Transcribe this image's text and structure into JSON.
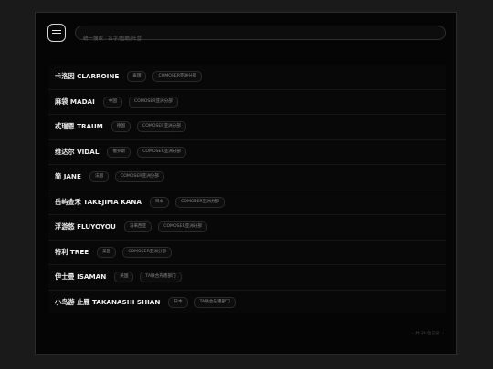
{
  "search": {
    "placeholder": "统一搜索 · 名字/国籍/阵营"
  },
  "artists": [
    {
      "name": "卡洛因 CLARROINE",
      "country": "泰国",
      "org": "COMOSER亚洲分部"
    },
    {
      "name": "麻袋 MADAI",
      "country": "中国",
      "org": "COMOSER亚洲分部"
    },
    {
      "name": "忒瑞恩 TRAUM",
      "country": "德国",
      "org": "COMOSER亚洲分部"
    },
    {
      "name": "维达尔 VIDAL",
      "country": "俄罗斯",
      "org": "COMOSER亚洲分部"
    },
    {
      "name": "简 JANE",
      "country": "法国",
      "org": "COMOSER亚洲分部"
    },
    {
      "name": "岳屿金禾 TAKEJIMA KANA",
      "country": "日本",
      "org": "COMOSER亚洲分部"
    },
    {
      "name": "浮游悠 FLUYOYOU",
      "country": "马来西亚",
      "org": "COMOSER亚洲分部"
    },
    {
      "name": "特利 TREE",
      "country": "美国",
      "org": "COMOSER亚洲分部"
    },
    {
      "name": "伊士曼 ISAMAN",
      "country": "英国",
      "org": "TA联合先遣部门"
    },
    {
      "name": "小鸟游 止雁 TAKANASHI SHIAN",
      "country": "日本",
      "org": "TA联合先遣部门"
    }
  ],
  "footer": {
    "prev": "‹",
    "label": "共 26 位记录",
    "next": "›"
  }
}
